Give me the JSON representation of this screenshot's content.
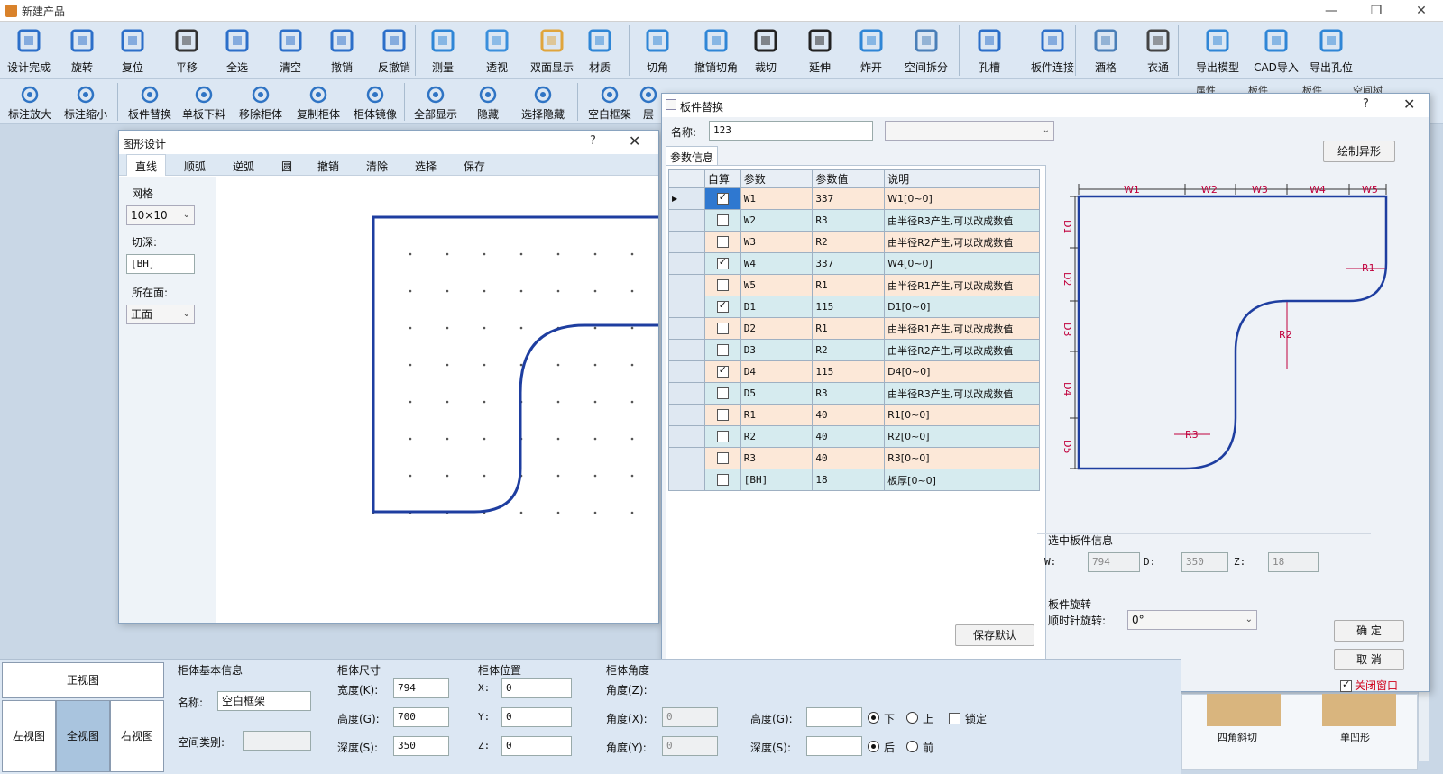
{
  "window": {
    "title": "新建产品",
    "controls": [
      "—",
      "❐",
      "✕"
    ]
  },
  "toolbar1": [
    {
      "name": "design-complete",
      "label": "设计完成",
      "icon": "save-icon"
    },
    {
      "name": "rotate",
      "label": "旋转",
      "icon": "rotate-icon"
    },
    {
      "name": "reset",
      "label": "复位",
      "icon": "reset-icon"
    },
    {
      "name": "pan",
      "label": "平移",
      "icon": "hand-icon"
    },
    {
      "name": "select-all",
      "label": "全选",
      "icon": "select-all-icon"
    },
    {
      "name": "clear",
      "label": "清空",
      "icon": "trash-icon"
    },
    {
      "name": "undo",
      "label": "撤销",
      "icon": "undo-icon"
    },
    {
      "name": "redo",
      "label": "反撤销",
      "icon": "redo-icon"
    },
    {
      "name": "measure",
      "label": "测量",
      "icon": "measure-icon"
    },
    {
      "name": "perspective",
      "label": "透视",
      "icon": "perspective-icon"
    },
    {
      "name": "double-sided",
      "label": "双面显示",
      "icon": "double-sided-icon"
    },
    {
      "name": "material",
      "label": "材质",
      "icon": "material-icon"
    },
    {
      "name": "cut-corner",
      "label": "切角",
      "icon": "cut-corner-icon"
    },
    {
      "name": "undo-cut-corner",
      "label": "撤销切角",
      "icon": "undo-cut-corner-icon"
    },
    {
      "name": "trim",
      "label": "裁切",
      "icon": "trim-icon"
    },
    {
      "name": "extend",
      "label": "延伸",
      "icon": "extend-icon"
    },
    {
      "name": "explode",
      "label": "炸开",
      "icon": "explode-icon"
    },
    {
      "name": "space-split",
      "label": "空间拆分",
      "icon": "space-split-icon"
    },
    {
      "name": "hole-slot",
      "label": "孔槽",
      "icon": "hole-slot-icon"
    },
    {
      "name": "board-connect",
      "label": "板件连接",
      "icon": "board-connect-icon"
    },
    {
      "name": "wine-grid",
      "label": "酒格",
      "icon": "wine-grid-icon"
    },
    {
      "name": "clothes-rail",
      "label": "衣通",
      "icon": "clothes-rail-icon"
    },
    {
      "name": "export-model",
      "label": "导出模型",
      "icon": "export-model-icon"
    },
    {
      "name": "cad-import",
      "label": "CAD导入",
      "icon": "cad-import-icon"
    },
    {
      "name": "export-holes",
      "label": "导出孔位",
      "icon": "export-pdf-icon"
    }
  ],
  "toolbar2": [
    {
      "name": "zoom-in-label",
      "label": "标注放大",
      "icon": "zoom-in-icon"
    },
    {
      "name": "zoom-out-label",
      "label": "标注缩小",
      "icon": "zoom-out-icon"
    },
    {
      "name": "board-replace",
      "label": "板件替换",
      "icon": "board-replace-icon"
    },
    {
      "name": "single-cut",
      "label": "单板下料",
      "icon": "single-cut-icon"
    },
    {
      "name": "remove-cabinet",
      "label": "移除柜体",
      "icon": "remove-cabinet-icon"
    },
    {
      "name": "copy-cabinet",
      "label": "复制柜体",
      "icon": "copy-cabinet-icon"
    },
    {
      "name": "mirror-cabinet",
      "label": "柜体镜像",
      "icon": "mirror-cabinet-icon"
    },
    {
      "name": "show-all",
      "label": "全部显示",
      "icon": "eye-icon"
    },
    {
      "name": "hide",
      "label": "隐藏",
      "icon": "eye-slash-icon"
    },
    {
      "name": "select-hide",
      "label": "选择隐藏",
      "icon": "eye-select-icon"
    },
    {
      "name": "empty-frame",
      "label": "空白框架",
      "icon": "empty-frame-icon"
    },
    {
      "name": "layer",
      "label": "层",
      "icon": "layer-icon"
    }
  ],
  "shape_dialog": {
    "title": "图形设计",
    "help": "?",
    "close": "✕",
    "tabs": [
      "直线",
      "顺弧",
      "逆弧",
      "圆",
      "撤销",
      "清除",
      "选择",
      "保存"
    ],
    "grid_label": "网格",
    "grid_value": "10×10",
    "depth_label": "切深:",
    "depth_value": "[BH]",
    "face_label": "所在面:",
    "face_value": "正面"
  },
  "replace_dialog": {
    "title": "板件替换",
    "help": "?",
    "close": "✕",
    "name_label": "名称:",
    "name_value": "123",
    "params_tab": "参数信息",
    "draw_button": "绘制异形",
    "columns": [
      "自算",
      "参数",
      "参数值",
      "说明"
    ],
    "rows": [
      {
        "checked": true,
        "param": "W1",
        "value": "337",
        "desc": "W1[0~0]"
      },
      {
        "checked": false,
        "param": "W2",
        "value": "R3",
        "desc": "由半径R3产生,可以改成数值"
      },
      {
        "checked": false,
        "param": "W3",
        "value": "R2",
        "desc": "由半径R2产生,可以改成数值"
      },
      {
        "checked": true,
        "param": "W4",
        "value": "337",
        "desc": "W4[0~0]"
      },
      {
        "checked": false,
        "param": "W5",
        "value": "R1",
        "desc": "由半径R1产生,可以改成数值"
      },
      {
        "checked": true,
        "param": "D1",
        "value": "115",
        "desc": "D1[0~0]"
      },
      {
        "checked": false,
        "param": "D2",
        "value": "R1",
        "desc": "由半径R1产生,可以改成数值"
      },
      {
        "checked": false,
        "param": "D3",
        "value": "R2",
        "desc": "由半径R2产生,可以改成数值"
      },
      {
        "checked": true,
        "param": "D4",
        "value": "115",
        "desc": "D4[0~0]"
      },
      {
        "checked": false,
        "param": "D5",
        "value": "R3",
        "desc": "由半径R3产生,可以改成数值"
      },
      {
        "checked": false,
        "param": "R1",
        "value": "40",
        "desc": "R1[0~0]"
      },
      {
        "checked": false,
        "param": "R2",
        "value": "40",
        "desc": "R2[0~0]"
      },
      {
        "checked": false,
        "param": "R3",
        "value": "40",
        "desc": "R3[0~0]"
      },
      {
        "checked": false,
        "param": "[BH]",
        "value": "18",
        "desc": "板厚[0~0]"
      }
    ],
    "save_default": "保存默认",
    "preview_labels": {
      "w": [
        "W1",
        "W2",
        "W3",
        "W4",
        "W5"
      ],
      "d": [
        "D1",
        "D2",
        "D3",
        "D4",
        "D5"
      ],
      "r": [
        "R1",
        "R2",
        "R3"
      ]
    },
    "selected_info_title": "选中板件信息",
    "w_label": "W:",
    "w_value": "794",
    "d_label": "D:",
    "d_value": "350",
    "z_label": "Z:",
    "z_value": "18",
    "rotation_title": "板件旋转",
    "rotation_label": "顺时针旋转:",
    "rotation_value": "0°",
    "ok": "确 定",
    "cancel": "取 消",
    "close_window": "关闭窗口"
  },
  "bottom": {
    "views": {
      "front": "正视图",
      "left": "左视图",
      "full": "全视图",
      "right": "右视图"
    },
    "basic_title": "柜体基本信息",
    "name_label": "名称:",
    "name_value": "空白框架",
    "space_label": "空间类别:",
    "size_title": "柜体尺寸",
    "width_label": "宽度(K):",
    "width_value": "794",
    "height_label": "高度(G):",
    "height_value": "700",
    "depth_label": "深度(S):",
    "depth_value": "350",
    "pos_title": "柜体位置",
    "x_label": "X:",
    "x_value": "0",
    "y_label": "Y:",
    "y_value": "0",
    "z_label": "Z:",
    "z_value": "0",
    "angle_title": "柜体角度",
    "az_label": "角度(Z):",
    "ax_label": "角度(X):",
    "ax_value": "0",
    "ay_label": "角度(Y):",
    "ay_value": "0",
    "h2_label": "高度(G):",
    "d2_label": "深度(S):",
    "radio_down": "下",
    "radio_up": "上",
    "lock": "锁定",
    "radio_back": "后",
    "radio_front": "前",
    "thumb1": "四角斜切",
    "thumb2": "单凹形"
  },
  "right_tabs": [
    "属性",
    "板件",
    "板件",
    "空间树"
  ]
}
